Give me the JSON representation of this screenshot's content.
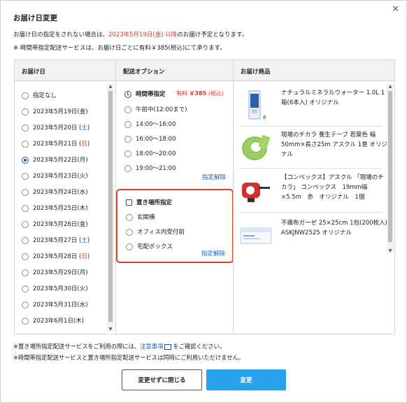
{
  "dialog": {
    "title": "お届け日変更",
    "close_glyph": "✕",
    "note1_pre": "お届け日の指定をされない場合は、",
    "note1_date": "2023年5月19日(金) 以降",
    "note1_post": "のお届け予定となります。",
    "note2": "※ 時間帯指定配送サービスは、お届け日ごとに有料￥385(税込)にて承ります。"
  },
  "columns": {
    "date_header": "お届け日",
    "option_header": "配送オプション",
    "product_header": "お届け商品"
  },
  "dates": [
    {
      "pre": "指定なし",
      "wd": "",
      "post": "",
      "type": "none",
      "selected": false
    },
    {
      "pre": "2023年5月19日(",
      "wd": "金",
      "post": ")",
      "type": "normal",
      "selected": false
    },
    {
      "pre": "2023年5月20日 (",
      "wd": "土",
      "post": ")",
      "type": "sat",
      "selected": false
    },
    {
      "pre": "2023年5月21日 (",
      "wd": "日",
      "post": ")",
      "type": "hol",
      "selected": false
    },
    {
      "pre": "2023年5月22日(",
      "wd": "月",
      "post": ")",
      "type": "normal",
      "selected": true
    },
    {
      "pre": "2023年5月23日(",
      "wd": "火",
      "post": ")",
      "type": "normal",
      "selected": false
    },
    {
      "pre": "2023年5月24日(",
      "wd": "水",
      "post": ")",
      "type": "normal",
      "selected": false
    },
    {
      "pre": "2023年5月25日(",
      "wd": "木",
      "post": ")",
      "type": "normal",
      "selected": false
    },
    {
      "pre": "2023年5月26日(",
      "wd": "金",
      "post": ")",
      "type": "normal",
      "selected": false
    },
    {
      "pre": "2023年5月27日 (",
      "wd": "土",
      "post": ")",
      "type": "sat",
      "selected": false
    },
    {
      "pre": "2023年5月28日 (",
      "wd": "日",
      "post": ")",
      "type": "hol",
      "selected": false
    },
    {
      "pre": "2023年5月29日(",
      "wd": "月",
      "post": ")",
      "type": "normal",
      "selected": false
    },
    {
      "pre": "2023年5月30日(",
      "wd": "火",
      "post": ")",
      "type": "normal",
      "selected": false
    },
    {
      "pre": "2023年5月31日(",
      "wd": "水",
      "post": ")",
      "type": "normal",
      "selected": false
    },
    {
      "pre": "2023年6月1日(",
      "wd": "木",
      "post": ")",
      "type": "normal",
      "selected": false
    }
  ],
  "time_option": {
    "label": "時間帯指定",
    "fee_label": "有料",
    "fee_amount": "￥385",
    "fee_tax": "(税込)",
    "slots": [
      "午前中(12:00まで)",
      "14:00〜16:00",
      "16:00〜18:00",
      "18:00〜20:00",
      "19:00〜21:00"
    ],
    "clear_label": "指定解除"
  },
  "place_option": {
    "label": "置き場所指定",
    "places": [
      "玄関横",
      "オフィス内受付前",
      "宅配ボックス"
    ],
    "clear_label": "指定解除"
  },
  "products": [
    {
      "name": "ナチュラルミネラルウォーター 1.0L 1箱(6本入) オリジナル",
      "badge": "6"
    },
    {
      "name": "現場のチカラ 養生テープ 若葉色 幅50mm×長さ25m アスクル 1巻 オリジナル",
      "badge": ""
    },
    {
      "name": "【コンベックス】アスクル 「現場のチカラ」 コンベックス　19mm幅×5.5m　赤　オリジナル　1個",
      "badge": ""
    },
    {
      "name": "不織布ガーゼ 25×25cm 1包(200枚入) ASKJNW2525 オリジナル",
      "badge": ""
    }
  ],
  "footnotes": {
    "fn1_pre": "※置き場所指定配送サービスをご利用の際には、",
    "fn1_link": "注意事項",
    "fn1_post": "をご確認ください。",
    "fn2": "※時間帯指定配送サービスと置き場所指定配送サービスは同時にご利用いただけません。"
  },
  "buttons": {
    "cancel": "変更せずに閉じる",
    "ok": "変更"
  },
  "colors": {
    "accent_blue": "#1a4fa3",
    "link_blue": "#1a5fc0",
    "red": "#e0322c",
    "highlight_border": "#d4451f",
    "primary_button": "#2aa3ef"
  }
}
